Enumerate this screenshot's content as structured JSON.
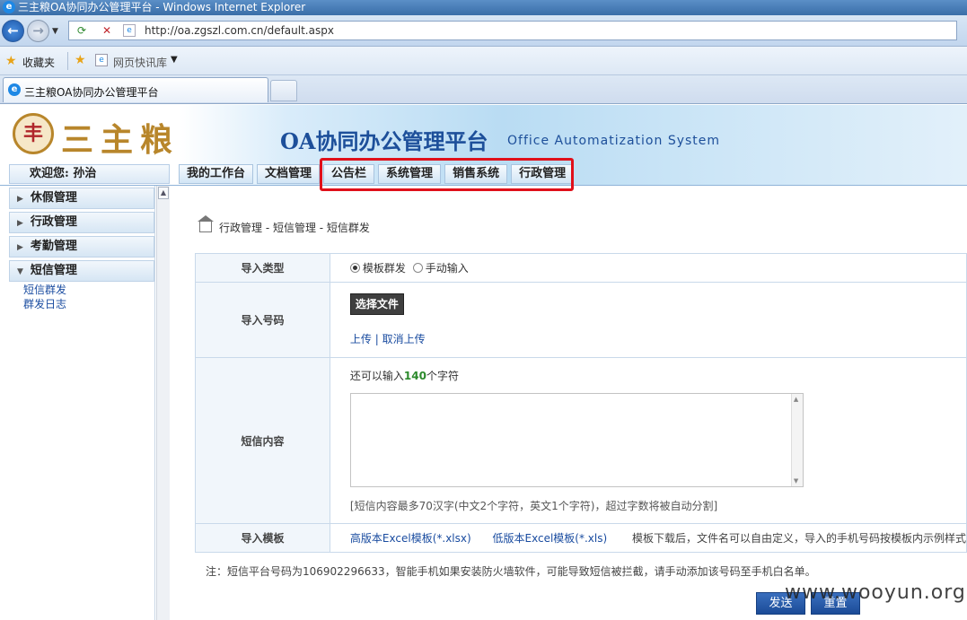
{
  "window": {
    "title": "三主粮OA协同办公管理平台 - Windows Internet Explorer"
  },
  "browser": {
    "url": "http://oa.zgszl.com.cn/default.aspx",
    "favorites_label": "收藏夹",
    "web_slice_label": "网页快讯库",
    "tab_title": "三主粮OA协同办公管理平台"
  },
  "header": {
    "logo_text": "三主粮",
    "logo_seal_char": "丰",
    "app_title": "OA协同办公管理平台",
    "app_subtitle": "Office Automatization System",
    "welcome": "欢迎您: 孙治"
  },
  "main_tabs": [
    {
      "label": "我的工作台"
    },
    {
      "label": "文档管理"
    },
    {
      "label": "公告栏"
    },
    {
      "label": "系统管理"
    },
    {
      "label": "销售系统"
    },
    {
      "label": "行政管理"
    }
  ],
  "sidebar": {
    "items": [
      {
        "label": "休假管理",
        "expanded": false
      },
      {
        "label": "行政管理",
        "expanded": false
      },
      {
        "label": "考勤管理",
        "expanded": false
      },
      {
        "label": "短信管理",
        "expanded": true
      }
    ],
    "sub_items": [
      {
        "label": "短信群发"
      },
      {
        "label": "群发日志"
      }
    ]
  },
  "breadcrumb": "行政管理 - 短信管理 - 短信群发",
  "form": {
    "import_type": {
      "label": "导入类型",
      "options": [
        {
          "label": "模板群发",
          "selected": true
        },
        {
          "label": "手动输入",
          "selected": false
        }
      ]
    },
    "import_numbers": {
      "label": "导入号码",
      "choose_file": "选择文件",
      "upload": "上传",
      "separator": "|",
      "cancel_upload": "取消上传"
    },
    "sms_content": {
      "label": "短信内容",
      "remaining_prefix": "还可以输入",
      "remaining_count": "140",
      "remaining_suffix": "个字符",
      "value": "",
      "hint": "[短信内容最多70汉字(中文2个字符，英文1个字符)，超过字数将被自动分割]"
    },
    "import_template": {
      "label": "导入模板",
      "high_version_link": "高版本Excel模板(*.xlsx)",
      "low_version_link": "低版本Excel模板(*.xls)",
      "tip": "模板下载后，文件名可以自由定义，导入的手机号码按模板内示例样式"
    }
  },
  "note": "注：短信平台号码为106902296633，智能手机如果安装防火墙软件，可能导致短信被拦截，请手动添加该号码至手机白名单。",
  "actions": {
    "send": "发送",
    "reset": "重置"
  },
  "watermark": "www.wooyun.org",
  "colors": {
    "highlight": "#e0101a",
    "link": "#1a4ca0",
    "header_blue": "#1d4f9a",
    "count_green": "#2c8a2c"
  }
}
